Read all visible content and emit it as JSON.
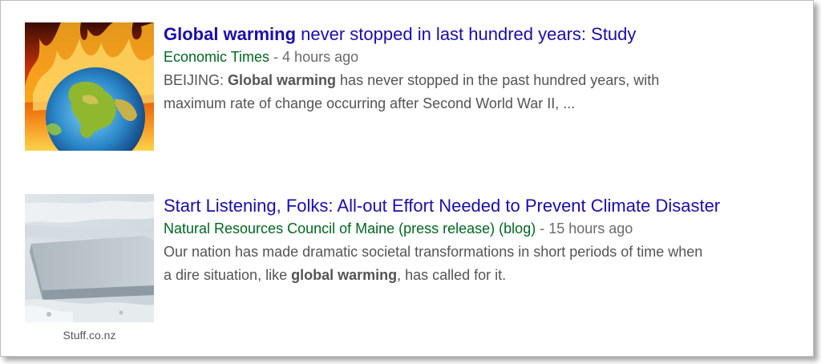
{
  "results": [
    {
      "title_bold": "Global warming",
      "title_rest": " never stopped in last hundred years: Study",
      "source": "Economic Times",
      "separator": " - ",
      "age": "4 hours ago",
      "snippet_line1_a": "BEIJING: ",
      "snippet_line1_b": "Global warming",
      "snippet_line1_c": " has never stopped in the past hundred years, with",
      "snippet_line2": "maximum rate of change occurring after Second World War II, ...",
      "thumbnail_icon": "burning-earth-icon",
      "caption": ""
    },
    {
      "title": "Start Listening, Folks: All-out Effort Needed to Prevent Climate Disaster",
      "source": "Natural Resources Council of Maine (press release) (blog)",
      "separator": " - ",
      "age": "15 hours ago",
      "snippet_line1": "Our nation has made dramatic societal transformations in short periods of time when",
      "snippet_line2_a": "a dire situation, like ",
      "snippet_line2_b": "global warming",
      "snippet_line2_c": ", has called for it.",
      "thumbnail_icon": "ice-shelf-icon",
      "caption": "Stuff.co.nz"
    }
  ],
  "colors": {
    "title": "#1a0dab",
    "source": "#006621",
    "meta": "#6a6a6a",
    "snippet": "#545454"
  }
}
